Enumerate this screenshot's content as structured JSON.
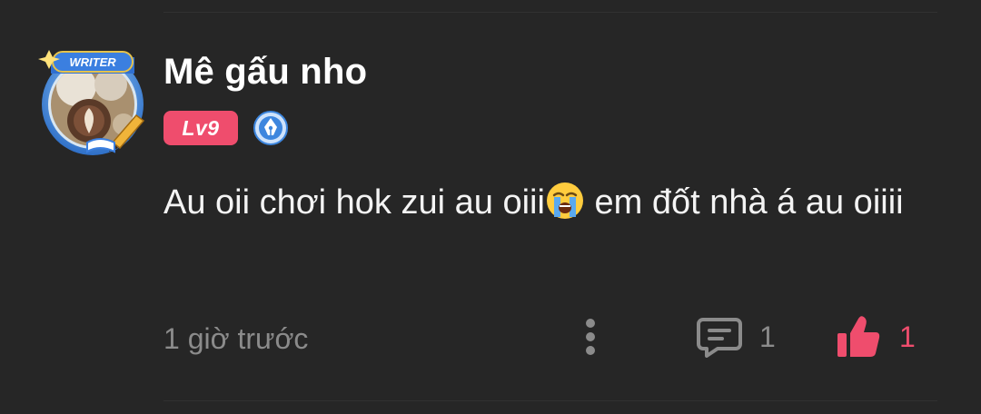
{
  "comment": {
    "username": "Mê gấu nho",
    "avatar_badge_text": "WRITER",
    "level_badge": "Lv9",
    "writer_badge_icon": "pen-nib-icon",
    "text_part1": "Au oii chơi hok zui au oiii",
    "emoji": "loudly-crying-face",
    "text_part2": " em đốt nhà á au oiiii",
    "timestamp": "1 giờ trước",
    "reply_count": "1",
    "like_count": "1"
  },
  "colors": {
    "background": "#262626",
    "accent_pink": "#ef4d6d",
    "muted_text": "#8b8b8b",
    "badge_blue": "#3d86de"
  }
}
